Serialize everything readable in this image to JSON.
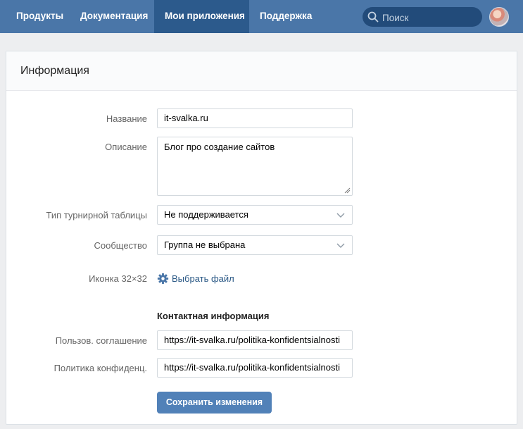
{
  "nav": {
    "products": "Продукты",
    "docs": "Документация",
    "my_apps": "Мои приложения",
    "support": "Поддержка"
  },
  "search": {
    "placeholder": "Поиск"
  },
  "card": {
    "title": "Информация"
  },
  "form": {
    "name_label": "Название",
    "name_value": "it-svalka.ru",
    "description_label": "Описание",
    "description_value": "Блог про создание сайтов",
    "leaderboard_label": "Тип турнирной таблицы",
    "leaderboard_value": "Не поддерживается",
    "community_label": "Сообщество",
    "community_value": "Группа не выбрана",
    "icon_label": "Иконка 32×32",
    "icon_link": "Выбрать файл",
    "contact_title": "Контактная информация",
    "terms_label": "Пользов. соглашение",
    "terms_value": "https://it-svalka.ru/politika-konfidentsialnosti",
    "privacy_label": "Политика конфиденц.",
    "privacy_value": "https://it-svalka.ru/politika-konfidentsialnosti",
    "save_button": "Сохранить изменения"
  },
  "colors": {
    "header_bg": "#4a76a8",
    "active_tab_bg": "#2c5a8c",
    "link": "#2a5885",
    "button_bg": "#5181b8"
  },
  "icons": [
    "search-icon",
    "gear-icon",
    "chevron-down-icon",
    "avatar"
  ]
}
